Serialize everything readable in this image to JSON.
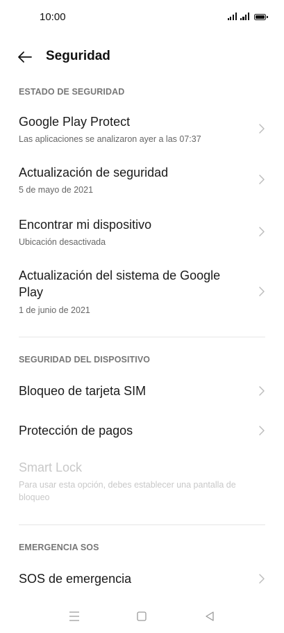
{
  "status_bar": {
    "time": "10:00"
  },
  "header": {
    "title": "Seguridad"
  },
  "sections": [
    {
      "header": "ESTADO DE SEGURIDAD",
      "items": [
        {
          "title": "Google Play Protect",
          "subtitle": "Las aplicaciones se analizaron ayer a las 07:37"
        },
        {
          "title": "Actualización de seguridad",
          "subtitle": "5 de mayo de 2021"
        },
        {
          "title": "Encontrar mi dispositivo",
          "subtitle": "Ubicación desactivada"
        },
        {
          "title": "Actualización del sistema de Google Play",
          "subtitle": "1 de junio de 2021"
        }
      ]
    },
    {
      "header": "SEGURIDAD DEL DISPOSITIVO",
      "items": [
        {
          "title": "Bloqueo de tarjeta SIM"
        },
        {
          "title": "Protección de pagos"
        },
        {
          "title": "Smart Lock",
          "subtitle": "Para usar esta opción, debes establecer una pantalla de bloqueo",
          "disabled": true
        }
      ]
    },
    {
      "header": "EMERGENCIA SOS",
      "items": [
        {
          "title": "SOS de emergencia"
        }
      ]
    }
  ],
  "icons": {
    "back": "arrow-left-icon",
    "chevron": "chevron-right-icon",
    "nav_menu": "menu-icon",
    "nav_home": "square-home-icon",
    "nav_back": "triangle-back-icon"
  },
  "colors": {
    "background": "#ffffff",
    "title_text": "#1a1a1a",
    "subtitle_text": "#666666",
    "section_header": "#777777",
    "disabled_text": "#c8c8c8",
    "divider": "#e6e6e6"
  }
}
